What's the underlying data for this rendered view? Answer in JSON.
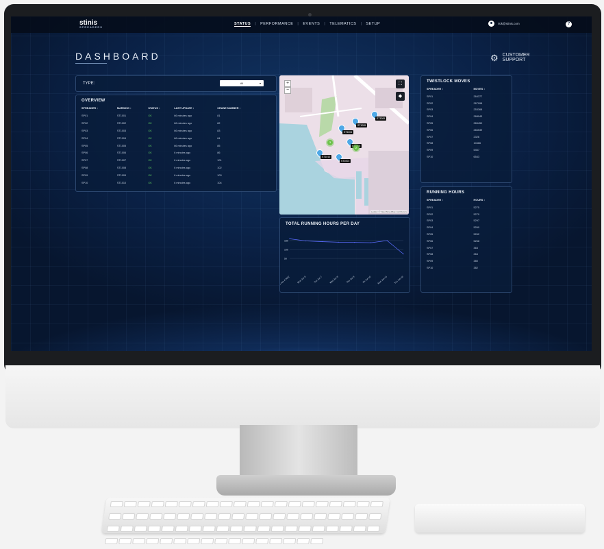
{
  "app": {
    "brand": "stinis",
    "brand_sub": "SPREADERS"
  },
  "nav": {
    "items": [
      "STATUS",
      "PERFORMANCE",
      "EVENTS",
      "TELEMATICS",
      "SETUP"
    ],
    "active": "STATUS",
    "separator": "|"
  },
  "user": {
    "email": "rick@stinis.com",
    "help": "?"
  },
  "page": {
    "title": "DASHBOARD"
  },
  "support": {
    "line1": "CUSTOMER",
    "line2": "SUPPORT"
  },
  "type_filter": {
    "label": "TYPE:",
    "value": "All"
  },
  "overview": {
    "title": "OVERVIEW",
    "columns": [
      "SPREADER ↕",
      "MARKING ↕",
      "STATUS ↕",
      "LAST UPDATE ↕",
      "CRANE NUMBER ↕"
    ],
    "rows": [
      [
        "SP01",
        "ST1001",
        "OK",
        "66 minutes ago",
        "81"
      ],
      [
        "SP02",
        "ST1002",
        "OK",
        "66 minutes ago",
        "82"
      ],
      [
        "SP03",
        "ST1003",
        "OK",
        "66 minutes ago",
        "83"
      ],
      [
        "SP04",
        "ST1004",
        "OK",
        "66 minutes ago",
        "84"
      ],
      [
        "SP05",
        "ST1005",
        "OK",
        "66 minutes ago",
        "85"
      ],
      [
        "SP06",
        "ST1006",
        "OK",
        "6 minutes ago",
        "86"
      ],
      [
        "SP07",
        "ST1007",
        "OK",
        "6 minutes ago",
        "101"
      ],
      [
        "SP08",
        "ST1008",
        "OK",
        "6 minutes ago",
        "102"
      ],
      [
        "SP09",
        "ST1009",
        "OK",
        "6 minutes ago",
        "103"
      ],
      [
        "SP10",
        "ST1010",
        "OK",
        "6 minutes ago",
        "104"
      ]
    ]
  },
  "map": {
    "zoom_in": "+",
    "zoom_out": "−",
    "attribution": "Leaflet | © OpenStreetMap contributors",
    "markers": [
      "ST1009",
      "ST1005",
      "ST1004",
      "ST1002",
      "ST1010",
      "ST1001"
    ],
    "clusters": [
      "3",
      "2"
    ]
  },
  "running_chart": {
    "title": "TOTAL RUNNING HOURS PER DAY"
  },
  "chart_data": {
    "type": "line",
    "title": "TOTAL RUNNING HOURS PER DAY",
    "x": [
      "Sat Jun 4 2022",
      "Mon Jun 6",
      "Tue Jun 7",
      "Wed Jun 8",
      "Thu Jun 9",
      "Fri Jun 10",
      "Mon Jun 13",
      "Thu Jun 16"
    ],
    "series": [
      {
        "values": [
          160,
          148,
          144,
          141,
          140,
          138,
          150,
          75
        ]
      }
    ],
    "y_ticks": [
      150,
      100,
      50
    ],
    "ylim": [
      0,
      200
    ],
    "grid": true,
    "color": "#5b6cff"
  },
  "twistlock": {
    "title": "TWISTLOCK MOVES",
    "columns": [
      "SPREADER ↕",
      "MOVES ↕"
    ],
    "rows": [
      [
        "SP01",
        "264377"
      ],
      [
        "SP02",
        "267998"
      ],
      [
        "SP03",
        "253368"
      ],
      [
        "SP04",
        "268043"
      ],
      [
        "SP05",
        "265450"
      ],
      [
        "SP06",
        "266539"
      ],
      [
        "SP07",
        "2326"
      ],
      [
        "SP08",
        "10466"
      ],
      [
        "SP09",
        "5467"
      ],
      [
        "SP10",
        "6543"
      ]
    ]
  },
  "running_hours": {
    "title": "RUNNING HOURS",
    "columns": [
      "SPREADER ↕",
      "HOURS ↕"
    ],
    "rows": [
      [
        "SP01",
        "5275"
      ],
      [
        "SP02",
        "5270"
      ],
      [
        "SP03",
        "5297"
      ],
      [
        "SP04",
        "5260"
      ],
      [
        "SP05",
        "5262"
      ],
      [
        "SP06",
        "5268"
      ],
      [
        "SP07",
        "363"
      ],
      [
        "SP08",
        "264"
      ],
      [
        "SP09",
        "380"
      ],
      [
        "SP10",
        "382"
      ]
    ]
  },
  "colors": {
    "status_ok": "#59c35d",
    "panel_bg": "#091c39",
    "accent": "#5b6cff"
  }
}
